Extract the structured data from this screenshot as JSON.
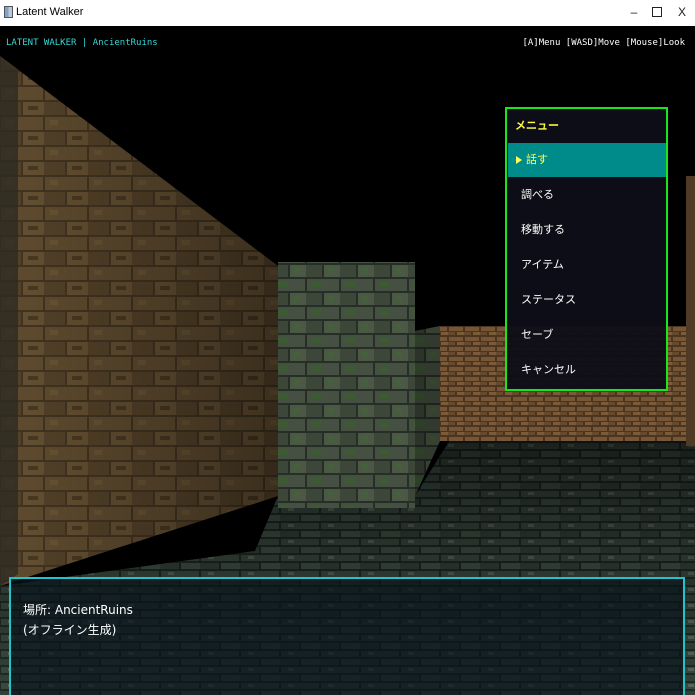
{
  "window": {
    "title": "Latent Walker",
    "minimize_glyph": "–",
    "close_glyph": "X"
  },
  "hud": {
    "left_text": "LATENT WALKER | AncientRuins",
    "right_text": "[A]Menu [WASD]Move [Mouse]Look"
  },
  "menu": {
    "title": "メニュー",
    "items": [
      {
        "label": "話す",
        "selected": true
      },
      {
        "label": "調べる",
        "selected": false
      },
      {
        "label": "移動する",
        "selected": false
      },
      {
        "label": "アイテム",
        "selected": false
      },
      {
        "label": "ステータス",
        "selected": false
      },
      {
        "label": "セーブ",
        "selected": false
      },
      {
        "label": "キャンセル",
        "selected": false
      }
    ]
  },
  "dialog": {
    "line1": "場所: AncientRuins",
    "line2": "(オフライン生成)"
  },
  "colors": {
    "hud_accent": "#35d7d7",
    "menu_border": "#19e619",
    "menu_highlight": "#008b8b",
    "menu_title": "#ffff40",
    "dialog_border": "#22c3c9"
  }
}
